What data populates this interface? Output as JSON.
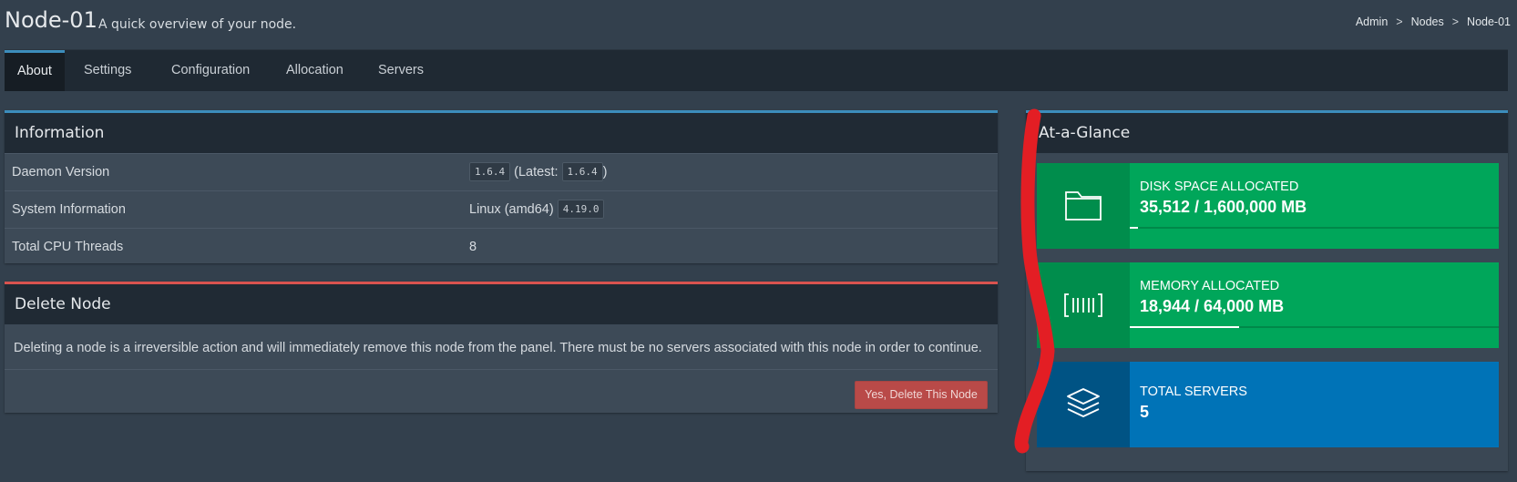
{
  "header": {
    "title": "Node-01",
    "subtitle": "A quick overview of your node.",
    "breadcrumb": [
      "Admin",
      "Nodes",
      "Node-01"
    ],
    "breadcrumb_separator": ">"
  },
  "tabs": [
    {
      "label": "About",
      "active": true
    },
    {
      "label": "Settings",
      "active": false
    },
    {
      "label": "Configuration",
      "active": false
    },
    {
      "label": "Allocation",
      "active": false
    },
    {
      "label": "Servers",
      "active": false
    }
  ],
  "information": {
    "title": "Information",
    "rows": {
      "daemon": {
        "label": "Daemon Version",
        "version": "1.6.4",
        "latest_prefix": "(Latest:",
        "latest": "1.6.4",
        "latest_suffix": ")"
      },
      "system": {
        "label": "System Information",
        "os": "Linux (amd64)",
        "kernel": "4.19.0"
      },
      "cpu": {
        "label": "Total CPU Threads",
        "value": "8"
      }
    }
  },
  "delete_node": {
    "title": "Delete Node",
    "text": "Deleting a node is a irreversible action and will immediately remove this node from the panel. There must be no servers associated with this node in order to continue.",
    "button_label": "Yes, Delete This Node"
  },
  "at_a_glance": {
    "title": "At-a-Glance",
    "disk": {
      "label": "DISK SPACE ALLOCATED",
      "value": "35,512 / 1,600,000 MB",
      "progress_fraction": 0.022,
      "icon": "folder-icon"
    },
    "memory": {
      "label": "MEMORY ALLOCATED",
      "value": "18,944 / 64,000 MB",
      "progress_fraction": 0.296,
      "icon": "barcode-icon"
    },
    "servers": {
      "label": "TOTAL SERVERS",
      "value": "5",
      "icon": "layers-icon"
    }
  },
  "colors": {
    "green": "#00a65a",
    "blue": "#0073b7",
    "danger": "#b94a48",
    "primary_border": "#3c8dbc",
    "annotation_red": "#e31e24"
  }
}
